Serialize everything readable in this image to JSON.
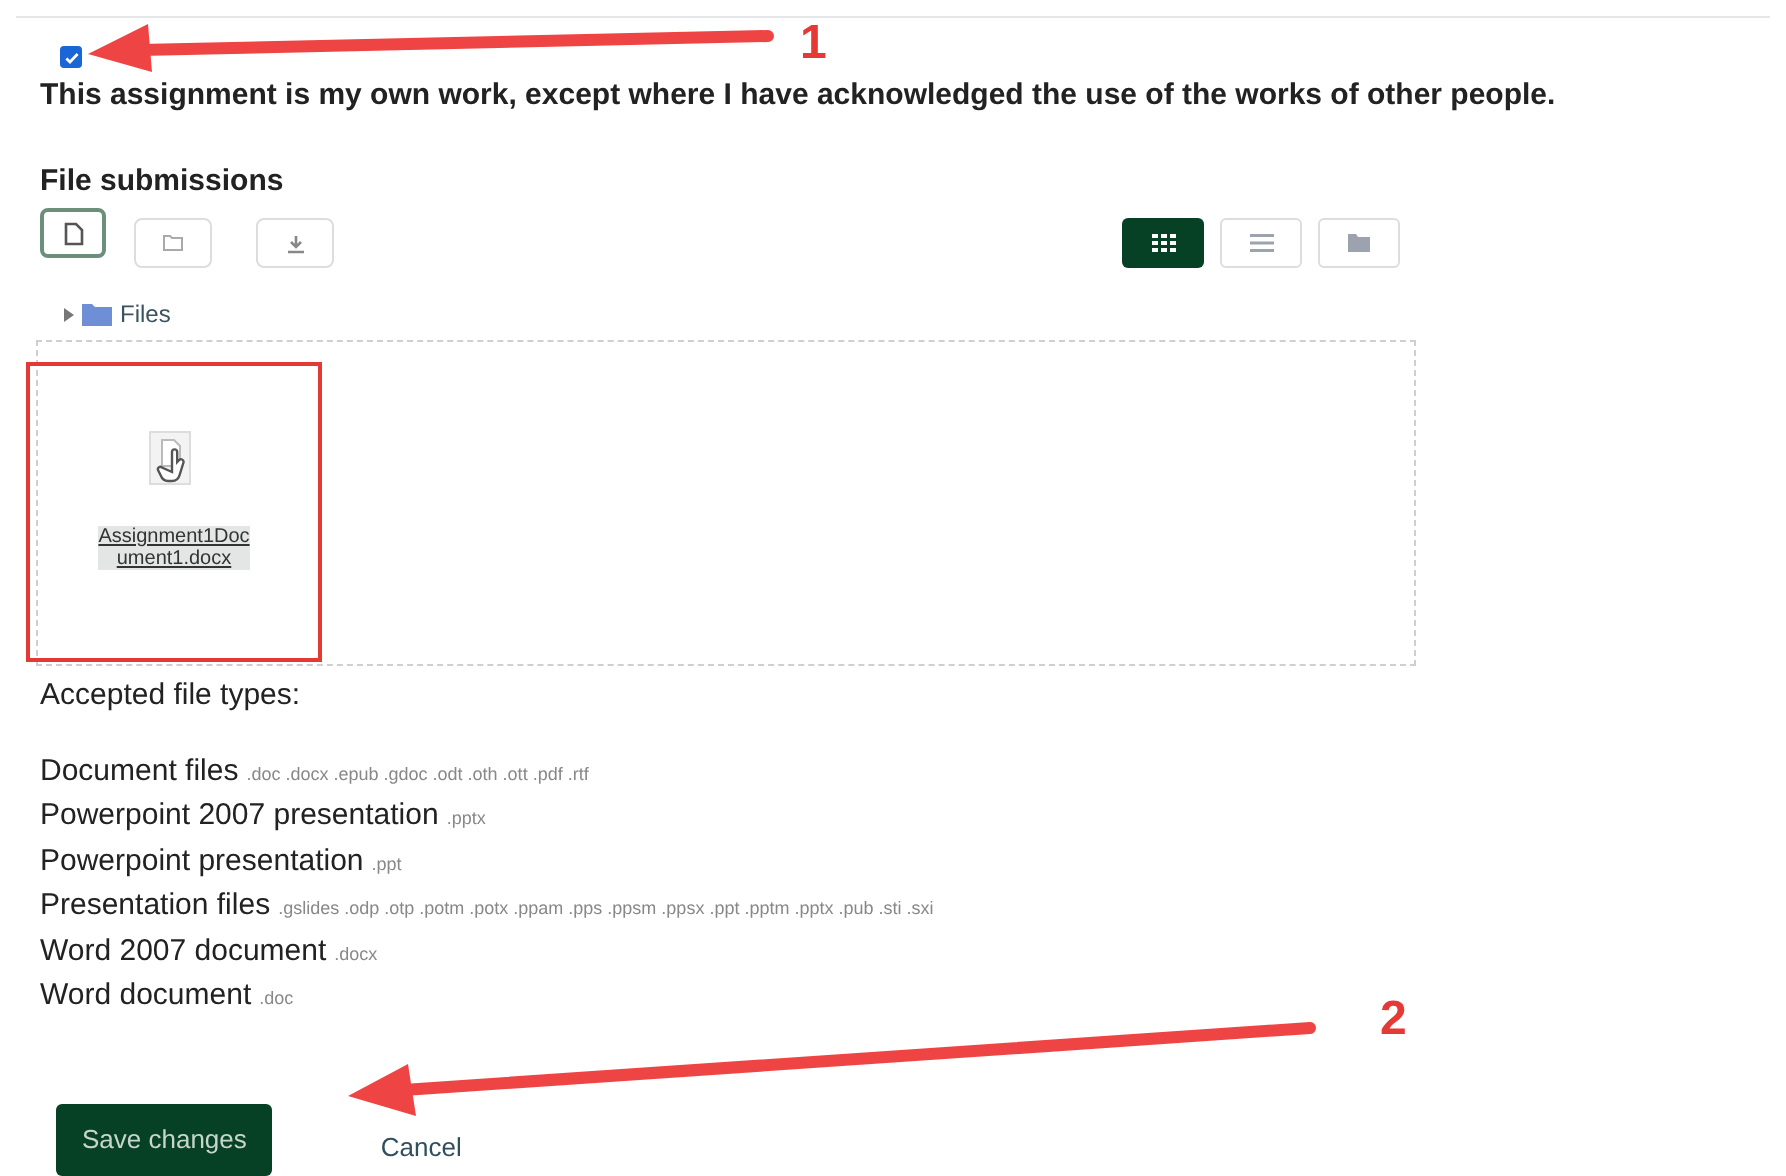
{
  "statement": {
    "checked": true,
    "text": "This assignment is my own work, except where I have acknowledged the use of the works of other people."
  },
  "file_submissions": {
    "title": "File submissions",
    "actions": [
      {
        "kind": "file",
        "selected": true
      },
      {
        "kind": "folder",
        "selected": false
      },
      {
        "kind": "download",
        "selected": false
      }
    ],
    "views": [
      {
        "kind": "grid",
        "selected": true
      },
      {
        "kind": "list",
        "selected": false
      },
      {
        "kind": "tree",
        "selected": false
      }
    ],
    "path": "Files",
    "files": [
      {
        "name": "Assignment1Doc ument1.docx",
        "highlighted": true
      }
    ]
  },
  "accepted": {
    "title": "Accepted file types:",
    "types": [
      {
        "name": "Document files",
        "extensions": ".doc .docx .epub .gdoc .odt .oth .ott .pdf .rtf"
      },
      {
        "name": "Powerpoint 2007 presentation",
        "extensions": ".pptx"
      },
      {
        "name": "Powerpoint presentation",
        "extensions": ".ppt"
      },
      {
        "name": "Presentation files",
        "extensions": ".gslides .odp .otp .potm .potx .ppam .pps .ppsm .ppsx .ppt .pptm .pptx .pub .sti .sxi"
      },
      {
        "name": "Word 2007 document",
        "extensions": ".docx"
      },
      {
        "name": "Word document",
        "extensions": ".doc"
      }
    ]
  },
  "buttons": {
    "save": "Save changes",
    "cancel": "Cancel"
  },
  "annotations": [
    {
      "label": "1"
    },
    {
      "label": "2"
    }
  ]
}
